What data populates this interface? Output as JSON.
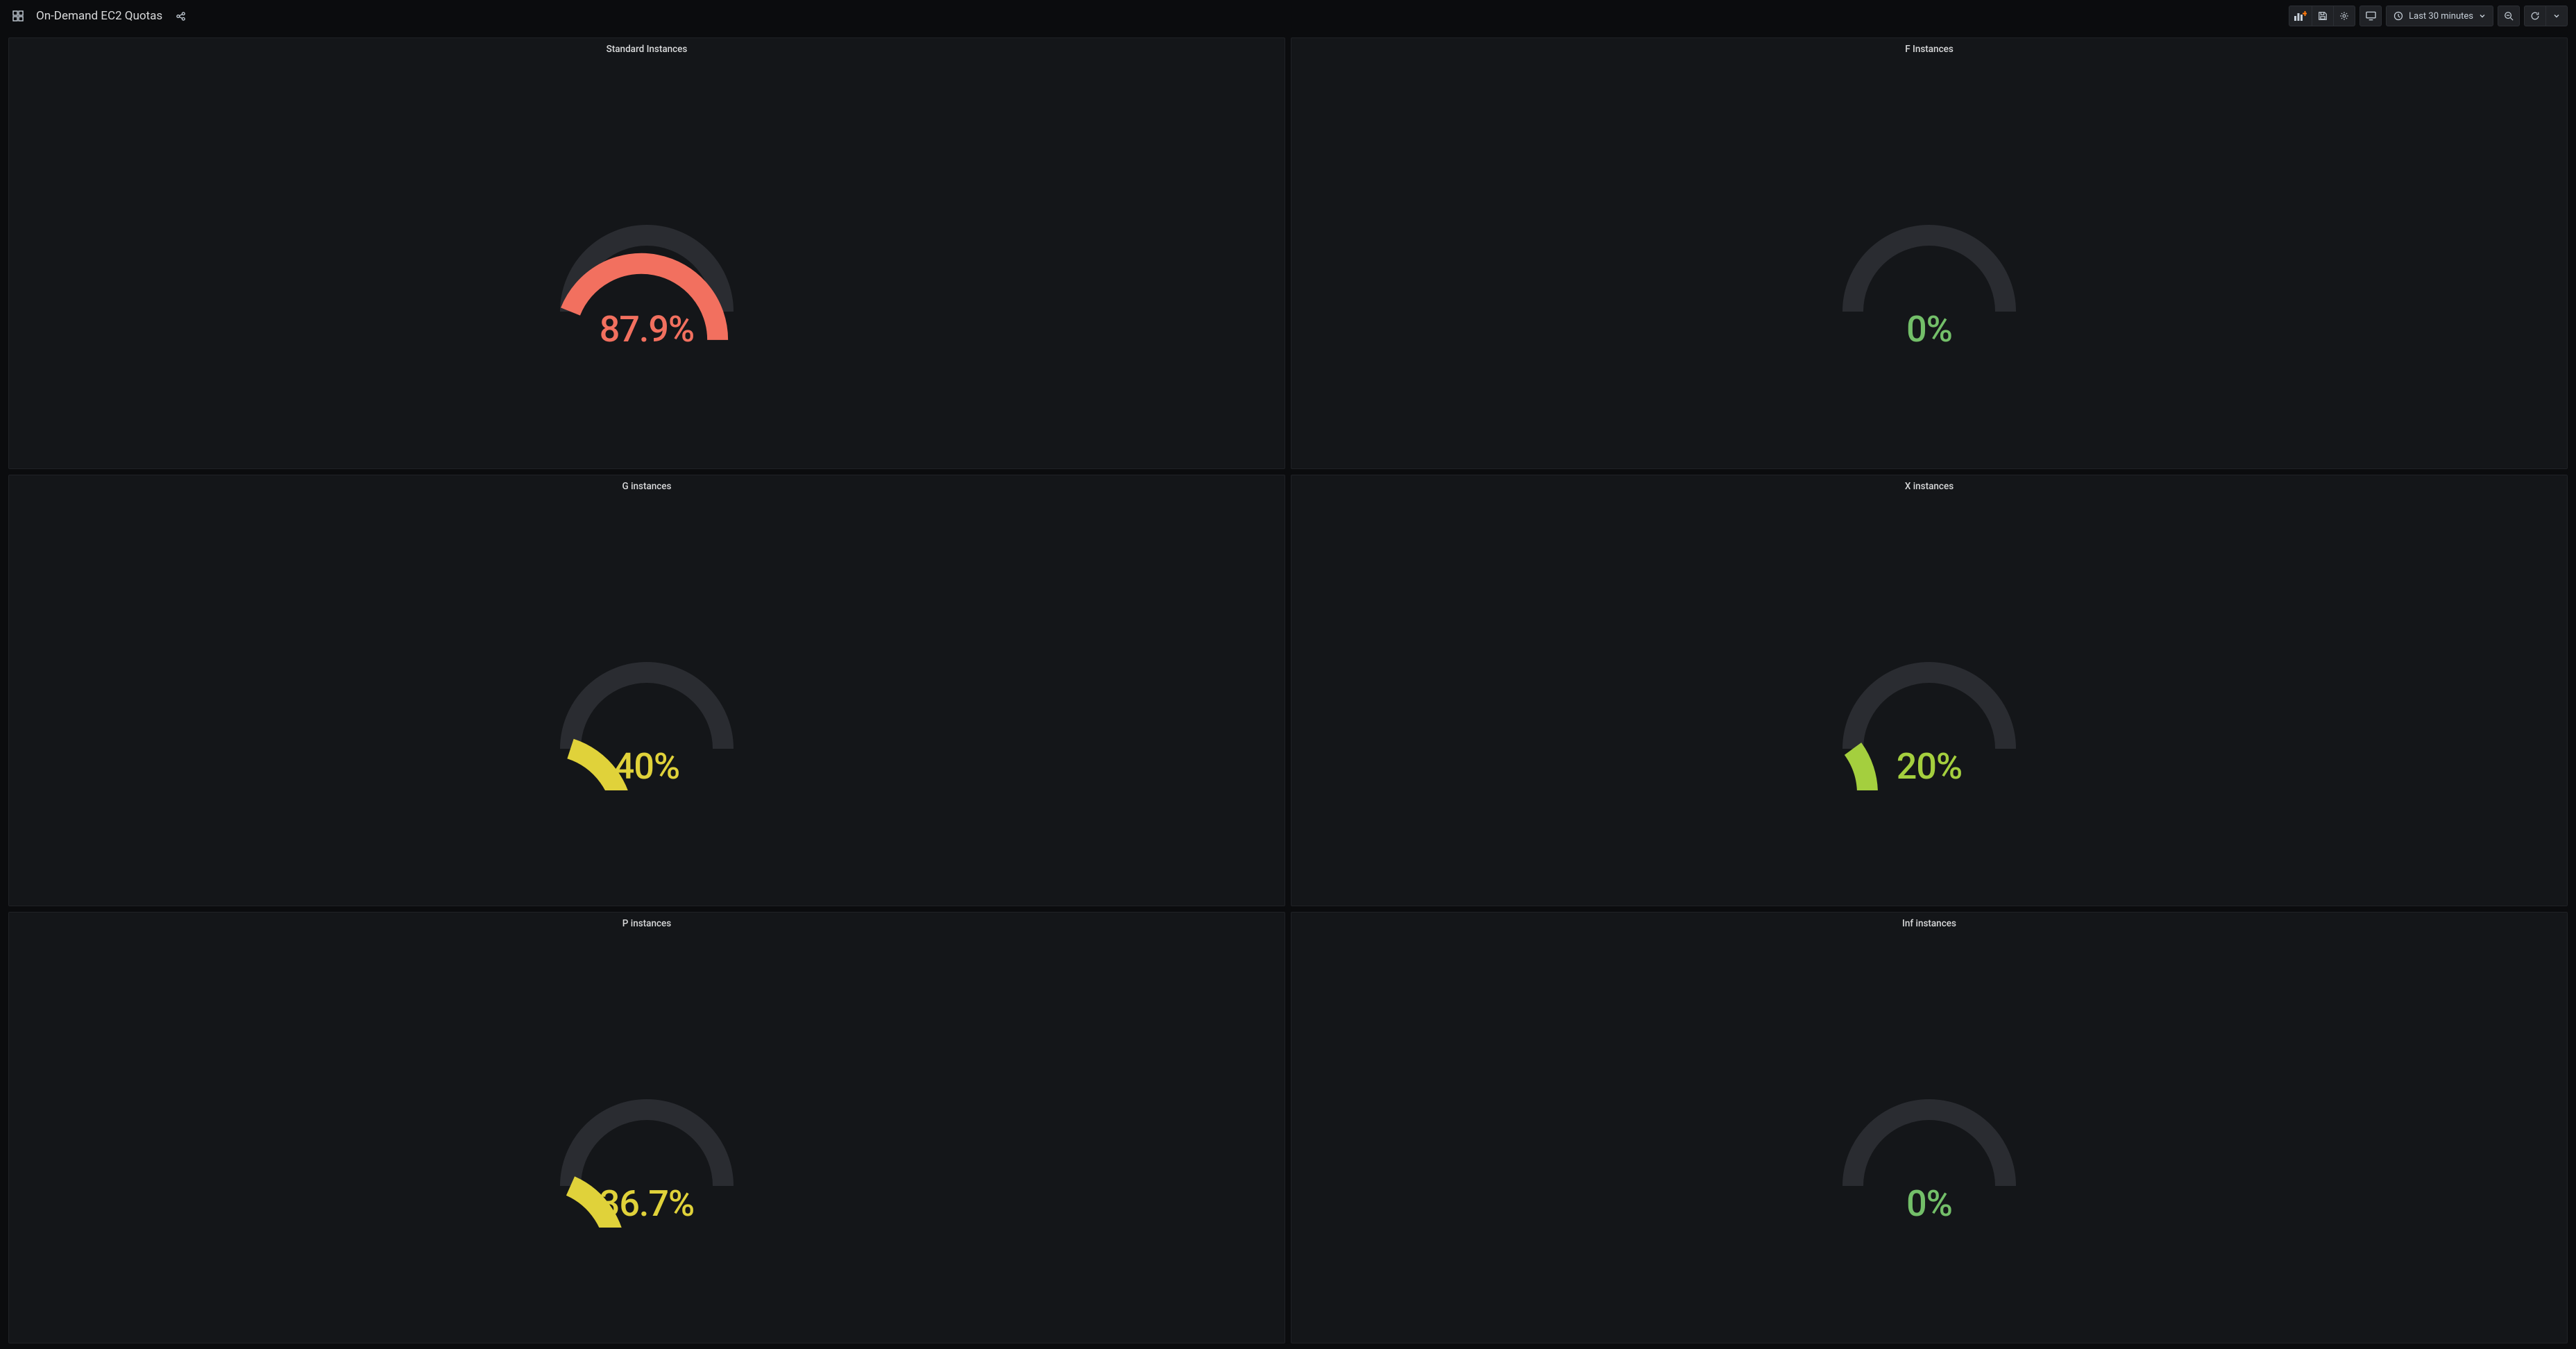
{
  "header": {
    "title": "On-Demand EC2 Quotas",
    "time_range_label": "Last 30 minutes"
  },
  "chart_data": [
    {
      "type": "gauge",
      "title": "Standard Instances",
      "value": 87.9,
      "display": "87.9%",
      "color": "#f2705f",
      "max": 100
    },
    {
      "type": "gauge",
      "title": "F Instances",
      "value": 0,
      "display": "0%",
      "color": "#73bf69",
      "max": 100
    },
    {
      "type": "gauge",
      "title": "G instances",
      "value": 40,
      "display": "40%",
      "color": "#e0d23a",
      "max": 100
    },
    {
      "type": "gauge",
      "title": "X instances",
      "value": 20,
      "display": "20%",
      "color": "#a4cf3e",
      "max": 100
    },
    {
      "type": "gauge",
      "title": "P instances",
      "value": 36.7,
      "display": "36.7%",
      "color": "#e0d23a",
      "max": 100
    },
    {
      "type": "gauge",
      "title": "Inf instances",
      "value": 0,
      "display": "0%",
      "color": "#73bf69",
      "max": 100
    }
  ],
  "colors": {
    "track": "#2a2c31"
  }
}
